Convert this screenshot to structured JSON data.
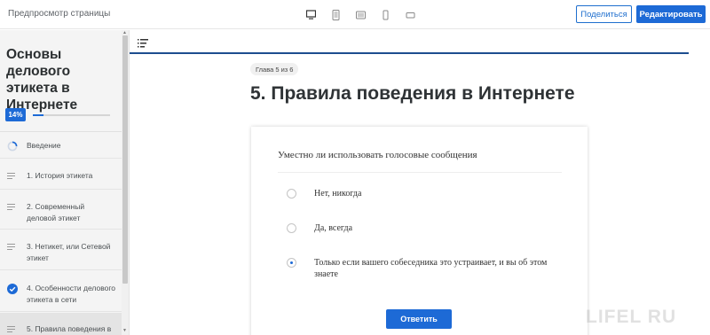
{
  "topbar": {
    "title": "Предпросмотр страницы",
    "share_label": "Поделиться",
    "edit_label": "Редактировать",
    "devices": [
      "desktop",
      "tablet-portrait",
      "tablet-landscape",
      "phone-portrait",
      "phone-landscape"
    ]
  },
  "sidebar": {
    "course_title": "Основы делового этикета в Интернете",
    "progress_label": "14%",
    "progress_value": 0.14,
    "lessons": [
      {
        "label": "Введение",
        "icon": "progress-ring-icon"
      },
      {
        "label": "1. История этикета",
        "icon": "lines-icon"
      },
      {
        "label": "2. Современный деловой этикет",
        "icon": "lines-icon"
      },
      {
        "label": "3. Нетикет, или Сетевой этикет",
        "icon": "lines-icon"
      },
      {
        "label": "4. Особенности делового этикета в сети",
        "icon": "check-circle-icon"
      },
      {
        "label": "5. Правила поведения в",
        "icon": "lines-icon"
      }
    ]
  },
  "content": {
    "chapter_tag": "Глава 5 из 6",
    "heading": "5. Правила поведения в Интернете"
  },
  "quiz": {
    "question": "Уместно ли использовать голосовые сообщения",
    "options": [
      {
        "label": "Нет, никогда",
        "checked": false
      },
      {
        "label": "Да, всегда",
        "checked": false
      },
      {
        "label": "Только если вашего собеседника это устраивает, и вы об этом знаете",
        "checked": true
      }
    ],
    "submit_label": "Ответить"
  },
  "watermark": "LIFEL   RU",
  "colors": {
    "accent": "#1d6ad6",
    "header_line": "#1d4d8f",
    "sidebar_bg": "#f4f4f4"
  }
}
